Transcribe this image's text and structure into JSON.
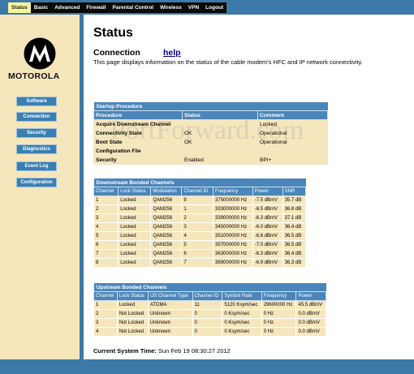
{
  "nav": {
    "items": [
      "Status",
      "Basic",
      "Advanced",
      "Firewall",
      "Parental Control",
      "Wireless",
      "VPN",
      "Logout"
    ],
    "active": "Status"
  },
  "brand": {
    "name": "MOTOROLA"
  },
  "sidebar": {
    "items": [
      "Software",
      "Connection",
      "Security",
      "Diagnostics",
      "Event Log",
      "Configuration"
    ]
  },
  "page": {
    "title": "Status",
    "section_title": "Connection",
    "help_label": "help",
    "description": "This page displays information on the status of the cable modem's HFC and IP network connectivity."
  },
  "startup": {
    "title": "Startup Procedure",
    "columns": [
      "Procedure",
      "Status",
      "Comment"
    ],
    "rows": [
      [
        "Acquire Downstream Channel",
        "",
        "Locked"
      ],
      [
        "Connectivity State",
        "OK",
        "Operational"
      ],
      [
        "Boot State",
        "OK",
        "Operational"
      ],
      [
        "Configuration File",
        "",
        ""
      ],
      [
        "Security",
        "Enabled",
        "BPI+"
      ]
    ]
  },
  "downstream": {
    "title": "Downstream Bonded Channels",
    "columns": [
      "Channel",
      "Lock Status",
      "Modulation",
      "Channel ID",
      "Frequency",
      "Power",
      "SNR"
    ],
    "rows": [
      [
        "1",
        "Locked",
        "QAM256",
        "8",
        "375000000 Hz",
        "-7.5 dBmV",
        "35.7 dB"
      ],
      [
        "2",
        "Locked",
        "QAM256",
        "1",
        "333000000 Hz",
        "-6.5 dBmV",
        "36.8 dB"
      ],
      [
        "3",
        "Locked",
        "QAM256",
        "2",
        "339000000 Hz",
        "-6.3 dBmV",
        "37.1 dB"
      ],
      [
        "4",
        "Locked",
        "QAM256",
        "3",
        "345000000 Hz",
        "-6.0 dBmV",
        "36.4 dB"
      ],
      [
        "5",
        "Locked",
        "QAM256",
        "4",
        "351000000 Hz",
        "-6.6 dBmV",
        "36.5 dB"
      ],
      [
        "6",
        "Locked",
        "QAM256",
        "5",
        "357000000 Hz",
        "-7.0 dBmV",
        "36.5 dB"
      ],
      [
        "7",
        "Locked",
        "QAM256",
        "6",
        "363000000 Hz",
        "-6.3 dBmV",
        "36.4 dB"
      ],
      [
        "8",
        "Locked",
        "QAM256",
        "7",
        "369000000 Hz",
        "-6.9 dBmV",
        "36.3 dB"
      ]
    ]
  },
  "upstream": {
    "title": "Upstream Bonded Channels",
    "columns": [
      "Channel",
      "Lock Status",
      "US Channel Type",
      "Channel ID",
      "Symbol Rate",
      "Frequency",
      "Power"
    ],
    "rows": [
      [
        "1",
        "Locked",
        "ATDMA",
        "11",
        "5120 Ksym/sec",
        "29600000 Hz",
        "45.5 dBmV"
      ],
      [
        "2",
        "Not Locked",
        "Unknown",
        "0",
        "0 Ksym/sec",
        "0 Hz",
        "0.0 dBmV"
      ],
      [
        "3",
        "Not Locked",
        "Unknown",
        "0",
        "0 Ksym/sec",
        "0 Hz",
        "0.0 dBmV"
      ],
      [
        "4",
        "Not Locked",
        "Unknown",
        "0",
        "0 Ksym/sec",
        "0 Hz",
        "0.0 dBmV"
      ]
    ]
  },
  "system_time": {
    "label": "Current System Time:",
    "value": "Sun Feb 19 08:30:27 2012"
  },
  "watermark": "PortForward.com",
  "colors": {
    "frame_blue": "#3d79a6",
    "panel_tan": "#f6e6bc",
    "active_tab": "#f5f598"
  }
}
